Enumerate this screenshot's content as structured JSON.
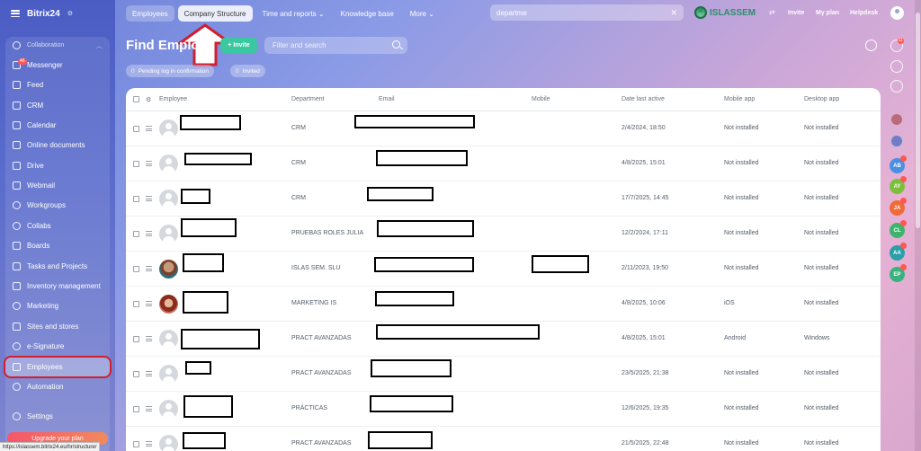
{
  "app": {
    "name": "Bitrix24"
  },
  "topnav": {
    "tabs": [
      {
        "label": "Employees"
      },
      {
        "label": "Company Structure"
      },
      {
        "label": "Time and reports"
      },
      {
        "label": "Knowledge base"
      },
      {
        "label": "More"
      }
    ],
    "search_value": "departme",
    "brand": "ISLASSEM",
    "invite": "Invite",
    "my_plan": "My plan",
    "helpdesk": "Helpdesk"
  },
  "sidebar": {
    "section": "Collaboration",
    "messenger_badge": "46",
    "items": [
      {
        "label": "Messenger",
        "icon": "messenger-icon"
      },
      {
        "label": "Feed",
        "icon": "feed-icon"
      },
      {
        "label": "CRM",
        "icon": "crm-icon"
      },
      {
        "label": "Calendar",
        "icon": "calendar-icon"
      },
      {
        "label": "Online documents",
        "icon": "documents-icon"
      },
      {
        "label": "Drive",
        "icon": "drive-icon"
      },
      {
        "label": "Webmail",
        "icon": "mail-icon"
      },
      {
        "label": "Workgroups",
        "icon": "workgroups-icon"
      },
      {
        "label": "Collabs",
        "icon": "collabs-icon"
      },
      {
        "label": "Boards",
        "icon": "boards-icon"
      },
      {
        "label": "Tasks and Projects",
        "icon": "tasks-icon"
      },
      {
        "label": "Inventory management",
        "icon": "inventory-icon"
      },
      {
        "label": "Marketing",
        "icon": "marketing-icon"
      },
      {
        "label": "Sites and stores",
        "icon": "sites-icon"
      },
      {
        "label": "e-Signature",
        "icon": "signature-icon"
      },
      {
        "label": "Employees",
        "icon": "employees-icon",
        "active": true
      },
      {
        "label": "Automation",
        "icon": "automation-icon"
      }
    ],
    "settings": "Settings",
    "upgrade": "Upgrade your plan"
  },
  "status_url": "https://islassem.bitrix24.eu/hr/structure/",
  "page": {
    "title": "Find Employ",
    "invite_button": "Invite",
    "filter_placeholder": "Filter and search",
    "chips": [
      {
        "count": "0",
        "label": "Pending log in confirmation"
      },
      {
        "count": "0",
        "label": "Invited"
      }
    ]
  },
  "table": {
    "columns": [
      "Employee",
      "Department",
      "Email",
      "Mobile",
      "Date last active",
      "Mobile app",
      "Desktop app"
    ],
    "rows": [
      {
        "department": "CRM",
        "last_active": "2/4/2024, 18:50",
        "mobile_app": "Not installed",
        "desktop_app": "Not installed"
      },
      {
        "department": "CRM",
        "last_active": "4/8/2025, 15:01",
        "mobile_app": "Not installed",
        "desktop_app": "Not installed"
      },
      {
        "department": "CRM",
        "last_active": "17/7/2025, 14:45",
        "mobile_app": "Not installed",
        "desktop_app": "Not installed"
      },
      {
        "department": "PRUEBAS ROLES JULIA",
        "last_active": "12/2/2024, 17:11",
        "mobile_app": "Not installed",
        "desktop_app": "Not installed"
      },
      {
        "department": "ISLAS SEM. SLU",
        "last_active": "2/11/2023, 19:50",
        "mobile_app": "Not installed",
        "desktop_app": "Not installed"
      },
      {
        "department": "MARKETING IS",
        "last_active": "4/8/2025, 10:06",
        "mobile_app": "iOS",
        "desktop_app": "Not installed"
      },
      {
        "department": "PRACT AVANZADAS",
        "last_active": "4/8/2025, 15:01",
        "mobile_app": "Android",
        "desktop_app": "Windows"
      },
      {
        "department": "PRACT AVANZADAS",
        "last_active": "23/5/2025, 21:38",
        "mobile_app": "Not installed",
        "desktop_app": "Not installed"
      },
      {
        "department": "PRÁCTICAS",
        "last_active": "12/6/2025, 19:35",
        "mobile_app": "Not installed",
        "desktop_app": "Not installed"
      },
      {
        "department": "PRACT AVANZADAS",
        "last_active": "21/5/2025, 22:48",
        "mobile_app": "Not installed",
        "desktop_app": "Not installed"
      }
    ]
  },
  "rail": {
    "notifications_badge": "11",
    "avatars": [
      {
        "initials": "AB",
        "color": "#4a90e2"
      },
      {
        "initials": "AY",
        "color": "#7bbf3a"
      },
      {
        "initials": "JA",
        "color": "#ef6b3a"
      },
      {
        "initials": "CL",
        "color": "#3bb56b"
      },
      {
        "initials": "AA",
        "color": "#29a0a8"
      },
      {
        "initials": "EP",
        "color": "#36b37e"
      }
    ]
  }
}
